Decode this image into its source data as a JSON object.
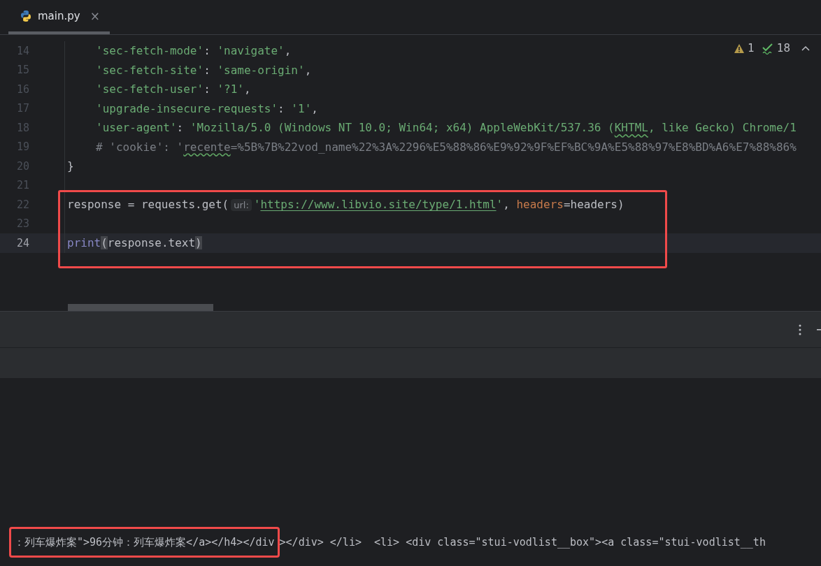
{
  "tabs": [
    {
      "label": "main.py",
      "close": "×",
      "selected": true
    }
  ],
  "inspections": {
    "warnings": "1",
    "checks": "18"
  },
  "lines": [
    {
      "number": "14",
      "indented": true,
      "current": false,
      "boxed": false,
      "tokens": [
        {
          "text": "'sec-fetch-mode'",
          "kind": "string"
        },
        {
          "text": ": ",
          "kind": "plain"
        },
        {
          "text": "'navigate'",
          "kind": "string"
        },
        {
          "text": ",",
          "kind": "plain"
        }
      ]
    },
    {
      "number": "15",
      "indented": true,
      "current": false,
      "boxed": false,
      "tokens": [
        {
          "text": "'sec-fetch-site'",
          "kind": "string"
        },
        {
          "text": ": ",
          "kind": "plain"
        },
        {
          "text": "'same-origin'",
          "kind": "string"
        },
        {
          "text": ",",
          "kind": "plain"
        }
      ]
    },
    {
      "number": "16",
      "indented": true,
      "current": false,
      "boxed": false,
      "tokens": [
        {
          "text": "'sec-fetch-user'",
          "kind": "string"
        },
        {
          "text": ": ",
          "kind": "plain"
        },
        {
          "text": "'?1'",
          "kind": "string"
        },
        {
          "text": ",",
          "kind": "plain"
        }
      ]
    },
    {
      "number": "17",
      "indented": true,
      "current": false,
      "boxed": false,
      "tokens": [
        {
          "text": "'upgrade-insecure-requests'",
          "kind": "string"
        },
        {
          "text": ": ",
          "kind": "plain"
        },
        {
          "text": "'1'",
          "kind": "string"
        },
        {
          "text": ",",
          "kind": "plain"
        }
      ]
    },
    {
      "number": "18",
      "indented": true,
      "current": false,
      "boxed": false,
      "tokens": [
        {
          "text": "'user-agent'",
          "kind": "string"
        },
        {
          "text": ": ",
          "kind": "plain"
        },
        {
          "text": "'Mozilla/5.0 (Windows NT 10.0; Win64; x64) AppleWebKit/537.36 (",
          "kind": "string"
        },
        {
          "text": "KHTML",
          "kind": "string-typo"
        },
        {
          "text": ", like Gecko) Chrome/1",
          "kind": "string"
        }
      ]
    },
    {
      "number": "19",
      "indented": true,
      "current": false,
      "boxed": false,
      "tokens": [
        {
          "text": "# 'cookie': '",
          "kind": "comment"
        },
        {
          "text": "recente",
          "kind": "comment-typo"
        },
        {
          "text": "=%5B%7B%22vod_name%22%3A%2296%E5%88%86%E9%92%9F%EF%BC%9A%E5%88%97%E8%BD%A6%E7%88%86%",
          "kind": "comment"
        }
      ]
    },
    {
      "number": "20",
      "indented": false,
      "current": false,
      "boxed": false,
      "tokens": [
        {
          "text": "}",
          "kind": "plain"
        }
      ]
    },
    {
      "number": "21",
      "current": false,
      "boxed": false
    },
    {
      "number": "22",
      "indented": false,
      "current": false,
      "boxed": true,
      "tokens": [
        {
          "text": "response = requests.get(",
          "kind": "plain"
        },
        {
          "text": "url:",
          "kind": "hint"
        },
        {
          "text": "'",
          "kind": "string"
        },
        {
          "text": "https://www.libvio.site/type/1.html",
          "kind": "url"
        },
        {
          "text": "'",
          "kind": "string"
        },
        {
          "text": ", ",
          "kind": "plain"
        },
        {
          "text": "headers",
          "kind": "param"
        },
        {
          "text": "=headers)",
          "kind": "plain"
        }
      ]
    },
    {
      "number": "23",
      "current": false,
      "boxed": true
    },
    {
      "number": "24",
      "indented": false,
      "current": true,
      "boxed": true,
      "tokens": [
        {
          "text": "print",
          "kind": "builtin"
        },
        {
          "text": "(",
          "kind": "brace-match"
        },
        {
          "text": "response.text",
          "kind": "plain"
        },
        {
          "text": ")",
          "kind": "brace-match"
        }
      ]
    }
  ],
  "console": [
    {
      "text": "：列车爆炸案\">96分钟：列车爆炸案</a></h4></div",
      "boxed": true
    },
    {
      "text": "></div> </li>  <li> <div class=\"stui-vodlist__box\"><a class=\"stui-vodlist__th",
      "boxed": false
    }
  ]
}
